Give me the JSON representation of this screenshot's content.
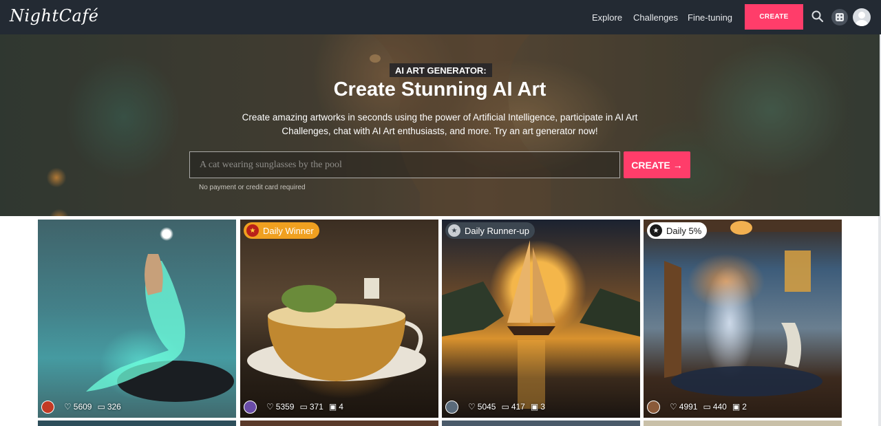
{
  "header": {
    "logo_text": "NightCafé",
    "nav": [
      {
        "label": "Explore"
      },
      {
        "label": "Challenges"
      },
      {
        "label": "Fine-tuning"
      }
    ],
    "create_label": "CREATE",
    "icons": [
      "search-icon",
      "dice-icon",
      "avatar"
    ]
  },
  "hero": {
    "tag": "AI ART GENERATOR:",
    "title": "Create Stunning AI Art",
    "subtitle": "Create amazing artworks in seconds using the power of Artificial Intelligence, participate in AI Art Challenges, chat with AI Art enthusiasts, and more. Try an art generator now!",
    "prompt_placeholder": "A cat wearing sunglasses by the pool",
    "create_label": "CREATE",
    "note": "No payment or credit card required"
  },
  "gallery": [
    {
      "badge": "",
      "likes": "5609",
      "comments": "326",
      "images": ""
    },
    {
      "badge": "Daily Winner",
      "likes": "5359",
      "comments": "371",
      "images": "4"
    },
    {
      "badge": "Daily Runner-up",
      "likes": "5045",
      "comments": "417",
      "images": "3"
    },
    {
      "badge": "Daily 5%",
      "likes": "4991",
      "comments": "440",
      "images": "2"
    }
  ],
  "colors": {
    "header_bg": "#232a33",
    "accent": "#ff3d6a",
    "winner_badge": "#f0a020",
    "runner_badge": "#3c4650"
  }
}
